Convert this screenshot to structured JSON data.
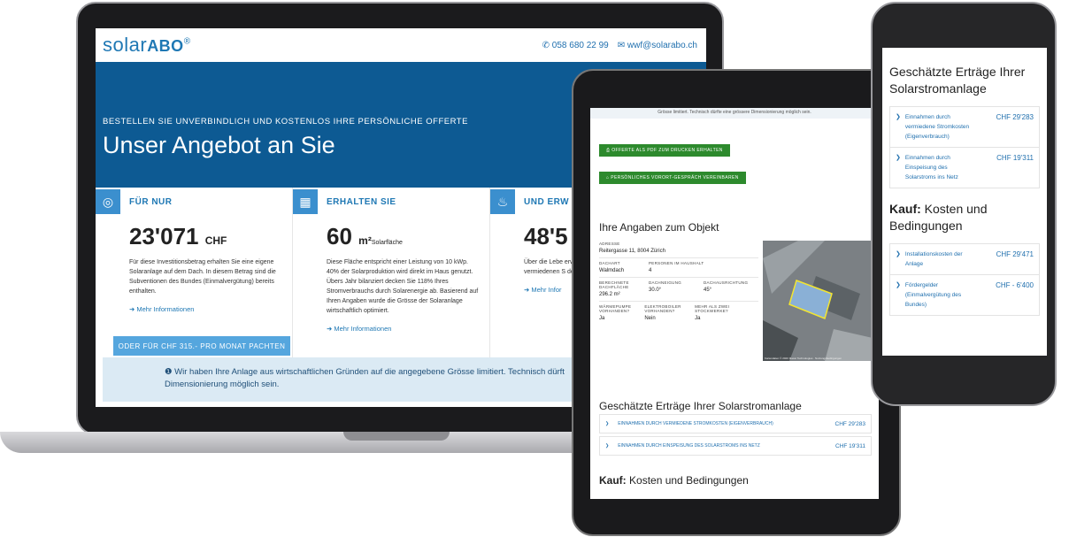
{
  "laptop": {
    "logo_text": "solar",
    "logo_bold": "ABO",
    "logo_reg": "®",
    "phone": "058 680 22 99",
    "email": "wwf@solarabo.ch",
    "hero_sub": "BESTELLEN SIE UNVERBINDLICH UND KOSTENLOS IHRE PERSÖNLICHE OFFERTE",
    "hero_title": "Unser Angebot an Sie",
    "cards": [
      {
        "label": "FÜR NUR",
        "big": "23'071",
        "unit": "CHF",
        "text": "Für diese Investitionsbetrag erhalten Sie eine eigene Solaranlage auf dem Dach. In diesem Betrag sind die Subventionen des Bundes (Einmalvergütung) bereits enthalten.",
        "link": "Mehr Informationen"
      },
      {
        "label": "ERHALTEN SIE",
        "big": "60",
        "unit": "m²",
        "unit_sub": "Solarfläche",
        "text": "Diese Fläche entspricht einer Leistung von 10 kWp. 40% der Solarproduktion wird direkt im Haus genutzt. Übers Jahr bilanziert decken Sie 118% Ihres Stromverbrauchs durch Solarenergie ab. Basierend auf Ihren Angaben wurde die Grösse der Solaranlage wirtschaftlich optimiert.",
        "link": "Mehr Informationen"
      },
      {
        "label": "UND ERW",
        "big": "48'5",
        "text": "Über die Lebe erwirtschaften Dieser Betrag vermiedenen S den Einnahme Überschusses",
        "link": "Mehr Infor"
      }
    ],
    "pacht_button": "ODER FÜR CHF 315.- PRO MONAT PACHTEN",
    "info_text": "Wir haben Ihre Anlage aus wirtschaftlichen Gründen auf die angegebene Grösse limitiert. Technisch dürft",
    "info_text2": "Dimensionierung möglich sein."
  },
  "tablet": {
    "top_strip": "Grösse limitiert. Technisch dürfte eine grössere Dimensionierung möglich sein.",
    "btn_pdf": "OFFERTE ALS PDF ZUM DRUCKEN ERHALTEN",
    "btn_meeting": "PERSÖNLICHES VORORT-GESPRÄCH VEREINBAREN",
    "section_object": "Ihre Angaben zum Objekt",
    "adresse_lbl": "ADRESSE",
    "adresse_val": "Reitergasse 11, 8004 Zürich",
    "dachart_lbl": "DACHART",
    "dachart_val": "Walmdach",
    "personen_lbl": "PERSONEN IM HAUSHALT",
    "personen_val": "4",
    "flaeche_lbl": "BERECHNETE DACHFLÄCHE",
    "flaeche_val": "296.2 m²",
    "neigung_lbl": "DACHNEIGUNG",
    "neigung_val": "30.0°",
    "richtung_lbl": "DACHAUSRICHTUNG",
    "richtung_val": "45°",
    "pumpe_lbl": "WÄRMEPUMPE VORHANDEN?",
    "pumpe_val": "Ja",
    "boiler_lbl": "ELEKTROBOILER VORHANDEN?",
    "boiler_val": "Nein",
    "stock_lbl": "MEHR ALS ZWEI STOCKWERKE?",
    "stock_val": "Ja",
    "map_credit": "Kartendaten © 2020 Maxar Technologies · Nutzungsbedingungen",
    "section_ertrag": "Geschätzte Erträge Ihrer Solarstromanlage",
    "ertrag_rows": [
      {
        "label": "EINNAHMEN DURCH VERMIEDENE STROMKOSTEN (EIGENVERBRAUCH)",
        "amount": "CHF 29'283"
      },
      {
        "label": "EINNAHMEN DURCH EINSPEISUNG DES SOLARSTROMS INS NETZ",
        "amount": "CHF 19'311"
      }
    ],
    "kauf_bold": "Kauf:",
    "kauf_rest": "Kosten und Bedingungen"
  },
  "phone": {
    "section_ertrag": "Geschätzte Erträge Ihrer Solarstromanlage",
    "ertrag_rows": [
      {
        "label": "Einnahmen durch vermiedene Stromkosten (Eigenverbrauch)",
        "amount": "CHF 29'283"
      },
      {
        "label": "Einnahmen durch Einspeisung des Solarstroms ins Netz",
        "amount": "CHF 19'311"
      }
    ],
    "kauf_bold": "Kauf:",
    "kauf_rest": "Kosten und Bedingungen",
    "kauf_rows": [
      {
        "label": "Installationskosten der Anlage",
        "amount": "CHF 29'471"
      },
      {
        "label": "Fördergelder (Einmalvergütung des Bundes)",
        "amount": "CHF - 6'400"
      }
    ]
  }
}
